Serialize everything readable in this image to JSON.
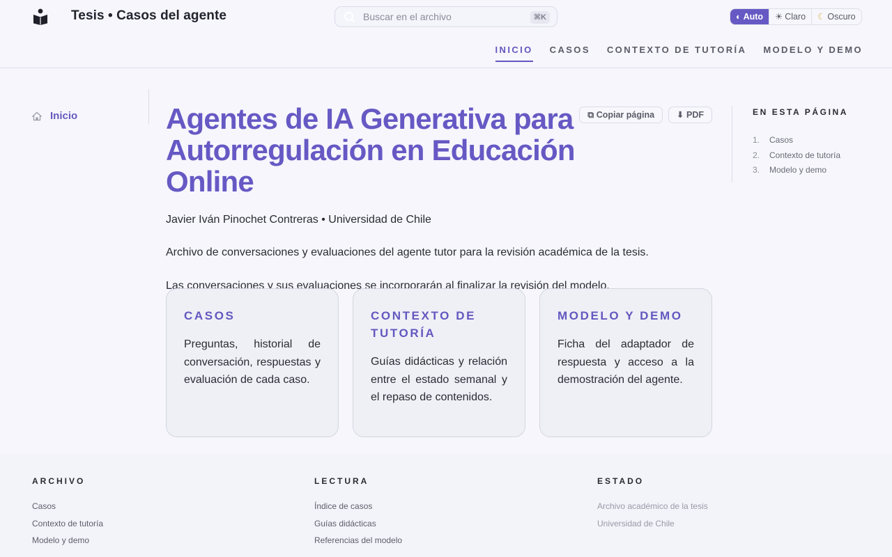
{
  "header": {
    "site_title": "Tesis • Casos del agente",
    "search": {
      "placeholder": "Buscar en el archivo",
      "shortcut": "⌘K"
    },
    "theme": {
      "options": [
        {
          "label": "Auto",
          "icon": "half-circle-icon",
          "active": true
        },
        {
          "label": "Claro",
          "icon": "sun-icon",
          "active": false
        },
        {
          "label": "Oscuro",
          "icon": "moon-icon",
          "active": false
        }
      ]
    },
    "nav": [
      "INICIO",
      "CASOS",
      "CONTEXTO DE TUTORÍA",
      "MODELO Y DEMO"
    ],
    "active_nav": "INICIO"
  },
  "sidebar": {
    "items": [
      {
        "label": "Inicio",
        "icon": "home-icon"
      }
    ]
  },
  "main": {
    "title": "Agentes de IA Generativa para Autorregulación en Educación Online",
    "actions": {
      "copy": "⧉ Copiar página",
      "pdf": "⬇ PDF"
    },
    "author": "Javier Iván Pinochet Contreras • Universidad de Chile",
    "intro": "Archivo de conversaciones y evaluaciones del agente tutor para la revisión académica de la tesis.",
    "note": "Las conversaciones y sus evaluaciones se incorporarán al finalizar la revisión del modelo.",
    "cards": [
      {
        "title": "CASOS",
        "text": "Preguntas, historial de conversación, respuestas y evaluación de cada caso."
      },
      {
        "title": "CONTEXTO DE TUTORÍA",
        "text": "Guías didácticas y relación entre el estado semanal y el repaso de contenidos."
      },
      {
        "title": "MODELO Y DEMO",
        "text": "Ficha del adaptador de respuesta y acceso a la demostración del agente."
      }
    ]
  },
  "toc": {
    "heading": "EN ESTA PÁGINA",
    "items": [
      {
        "num": "1.",
        "label": "Casos"
      },
      {
        "num": "2.",
        "label": "Contexto de tutoría"
      },
      {
        "num": "3.",
        "label": "Modelo y demo"
      }
    ]
  },
  "footer": {
    "columns": [
      {
        "heading": "ARCHIVO",
        "links": [
          "Casos",
          "Contexto de tutoría",
          "Modelo y demo"
        ]
      },
      {
        "heading": "LECTURA",
        "links": [
          "Índice de casos",
          "Guías didácticas",
          "Referencias del modelo"
        ]
      },
      {
        "heading": "ESTADO",
        "links": [
          "Archivo académico de la tesis",
          "Universidad de Chile"
        ]
      }
    ]
  },
  "colors": {
    "accent": "#6659c4",
    "text": "#2b2b34",
    "background": "#f6f6fc",
    "card_bg": "#eef0f6"
  }
}
